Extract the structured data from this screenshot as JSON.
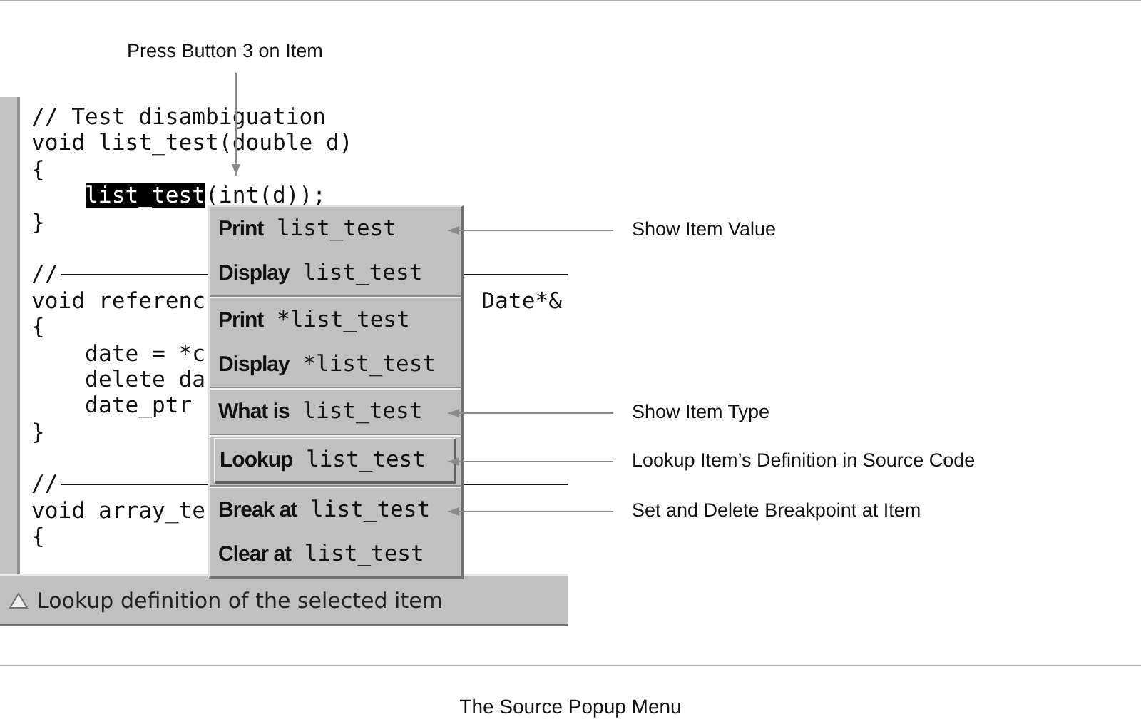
{
  "callouts": {
    "top": "Press Button 3 on Item",
    "side": [
      {
        "text": "Show Item Value"
      },
      {
        "text": "Show Item Type"
      },
      {
        "text": "Lookup Item’s Definition in Source Code"
      },
      {
        "text": "Set and Delete Breakpoint at Item"
      }
    ]
  },
  "source": {
    "lines": [
      {
        "kind": "code",
        "parts": [
          {
            "text": "// Test disambiguation",
            "highlighted": false
          }
        ]
      },
      {
        "kind": "code",
        "parts": [
          {
            "text": "void list_test(double d)",
            "highlighted": false
          }
        ]
      },
      {
        "kind": "code",
        "parts": [
          {
            "text": "{",
            "highlighted": false
          }
        ]
      },
      {
        "kind": "code",
        "parts": [
          {
            "text": "list_test",
            "highlighted": true
          },
          {
            "text": "(int(d));",
            "highlighted": false
          }
        ]
      },
      {
        "kind": "code",
        "parts": [
          {
            "text": "}",
            "highlighted": false
          }
        ]
      },
      {
        "kind": "blank"
      },
      {
        "kind": "rule",
        "text": "//"
      },
      {
        "kind": "code",
        "parts": [
          {
            "text": "void referenc",
            "highlighted": false
          }
        ],
        "tail": "Date*&"
      },
      {
        "kind": "code",
        "parts": [
          {
            "text": "{",
            "highlighted": false
          }
        ]
      },
      {
        "kind": "code",
        "parts": [
          {
            "text": "    date = *c",
            "highlighted": false
          }
        ]
      },
      {
        "kind": "code",
        "parts": [
          {
            "text": "    delete da",
            "highlighted": false
          }
        ]
      },
      {
        "kind": "code",
        "parts": [
          {
            "text": "    date_ptr",
            "highlighted": false
          }
        ]
      },
      {
        "kind": "code",
        "parts": [
          {
            "text": "}",
            "highlighted": false
          }
        ]
      },
      {
        "kind": "blank"
      },
      {
        "kind": "rule",
        "text": "//"
      },
      {
        "kind": "code",
        "parts": [
          {
            "text": "void array_te",
            "highlighted": false
          }
        ]
      },
      {
        "kind": "code",
        "parts": [
          {
            "text": "{",
            "highlighted": false
          }
        ]
      }
    ]
  },
  "popup_menu": {
    "groups": [
      [
        {
          "label": "**Print** list_test",
          "selected": false
        },
        {
          "label": "**Display** list_test",
          "selected": false
        }
      ],
      [
        {
          "label": "**Print** *list_test",
          "selected": false
        },
        {
          "label": "**Display** *list_test",
          "selected": false
        }
      ],
      [
        {
          "label": "**What is** list_test",
          "selected": false
        }
      ],
      [
        {
          "label": "**Lookup** list_test",
          "selected": true
        }
      ],
      [
        {
          "label": "**Break at** list_test",
          "selected": false
        },
        {
          "label": "**Clear at** list_test",
          "selected": false
        }
      ]
    ]
  },
  "status_bar": "Lookup definition of the selected item",
  "caption": "The Source Popup Menu"
}
